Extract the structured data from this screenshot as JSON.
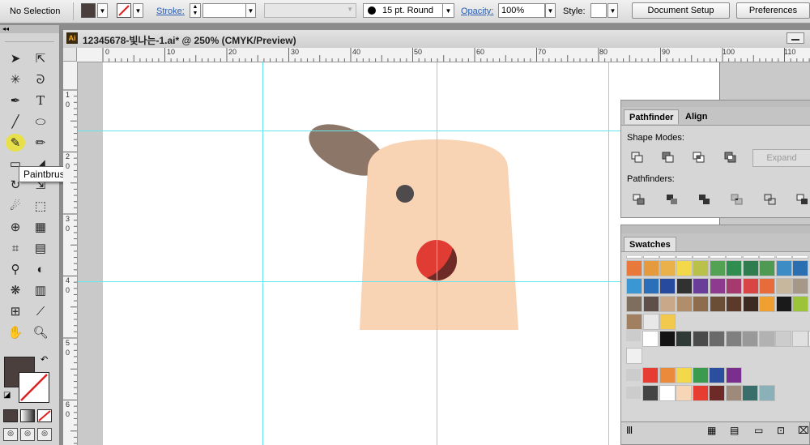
{
  "control_bar": {
    "selection_text": "No Selection",
    "stroke_label": "Stroke:",
    "brush_label": "15 pt. Round",
    "opacity_label": "Opacity:",
    "opacity_value": "100%",
    "style_label": "Style:",
    "document_setup_label": "Document Setup",
    "preferences_label": "Preferences"
  },
  "document": {
    "tab_title": "12345678-빛나는-1.ai* @ 250% (CMYK/Preview)",
    "ruler_h_labels": [
      "0",
      "10",
      "20",
      "30",
      "40",
      "50",
      "60",
      "70",
      "80",
      "90",
      "100",
      "110"
    ],
    "ruler_v_labels": [
      "1",
      "0",
      "2",
      "3",
      "4",
      "5",
      "6",
      "0",
      "0",
      "0",
      "0",
      "0"
    ]
  },
  "tools": {
    "tooltip": "Paintbrush Tool (B)"
  },
  "pathfinder_panel": {
    "tab_pathfinder": "Pathfinder",
    "tab_align": "Align",
    "shape_modes_label": "Shape Modes:",
    "pathfinders_label": "Pathfinders:",
    "expand_label": "Expand"
  },
  "swatches_panel": {
    "tab_label": "Swatches",
    "rows": [
      [
        "#ffffff",
        "#ffffff",
        "#ffffff",
        "#ffffff",
        "#ffffff",
        "#ffffff",
        "#ffffff",
        "#ffffff",
        "#ffffff",
        "#ffffff",
        "#ffffff"
      ],
      [
        "#e8793a",
        "#e59a3e",
        "#eab04a",
        "#f3d84a",
        "#b9c14a",
        "#53a153",
        "#2f8e4f",
        "#2f7d4e",
        "#4e9a52",
        "#3d8cc5",
        "#2c6fb1"
      ],
      [
        "#3b97d3",
        "#2b6fb8",
        "#274a9e",
        "#313131",
        "#6a3d9a",
        "#8e3a8e",
        "#a63a6e",
        "#d94545",
        "#e86b3b",
        "#c7b79d",
        "#a59888"
      ],
      [
        "#7e6e5e",
        "#5e5048",
        "#c9a88a",
        "#b08d6b",
        "#8d6d4e",
        "#6b4e36",
        "#5b3a2a",
        "#3d2a20",
        "#f0a030",
        "#1a1a1a",
        "#9bc43b"
      ],
      [
        "#a08060",
        "#e8e8e8",
        "#f2c94c"
      ],
      [
        "#ffffff",
        "#141414",
        "#2f3a36",
        "#4a4a4a",
        "#6a6a6a",
        "#808080",
        "#999999",
        "#b2b2b2",
        "#cccccc",
        "#e0e0e0",
        "#f5f5f5"
      ],
      [
        "#f0f0f0"
      ],
      [
        "#e63c32",
        "#ec8a3c",
        "#f3d84a",
        "#3a9a4e",
        "#2c4e9e",
        "#7a2e8e"
      ],
      [
        "#444444",
        "#ffffff",
        "#f7d6b8",
        "#e63c32",
        "#6e2a26",
        "#9e8a7a",
        "#3a6e6a",
        "#8ab0b8"
      ]
    ]
  },
  "colors": {
    "fill_swatch": "#4a3f3d",
    "skin": "#f8d3b4",
    "ear": "#8c7667",
    "eye": "#4f4a4b",
    "nose": "#e03c33",
    "nose_shadow": "#6e2a26",
    "guide": "#63e6ee"
  }
}
